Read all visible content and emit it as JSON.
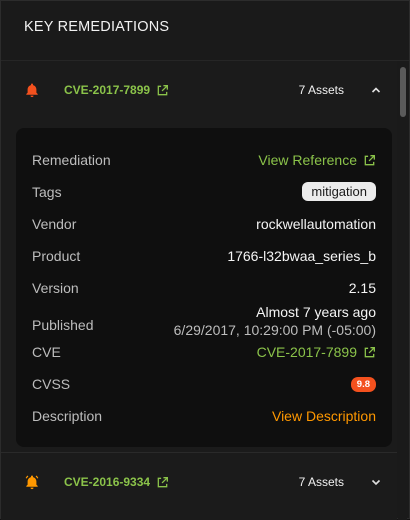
{
  "panel": {
    "title": "KEY REMEDIATIONS"
  },
  "remediations": [
    {
      "cve": "CVE-2017-7899",
      "assets": "7 Assets",
      "expanded": true,
      "severity_color": "#f4511e",
      "details": {
        "remediation_label": "Remediation",
        "remediation_value": "View Reference",
        "tags_label": "Tags",
        "tag": "mitigation",
        "vendor_label": "Vendor",
        "vendor": "rockwellautomation",
        "product_label": "Product",
        "product": "1766-l32bwaa_series_b",
        "version_label": "Version",
        "version": "2.15",
        "published_label": "Published",
        "published_relative": "Almost 7 years ago",
        "published_exact": "6/29/2017, 10:29:00 PM (-05:00)",
        "cve_label": "CVE",
        "cve_value": "CVE-2017-7899",
        "cvss_label": "CVSS",
        "cvss": "9.8",
        "description_label": "Description",
        "description_value": "View Description"
      }
    },
    {
      "cve": "CVE-2016-9334",
      "assets": "7 Assets",
      "expanded": false,
      "severity_color": "#ff9800"
    }
  ],
  "colors": {
    "link_green": "#8bc34a",
    "orange": "#ff9800",
    "critical": "#f4511e"
  }
}
